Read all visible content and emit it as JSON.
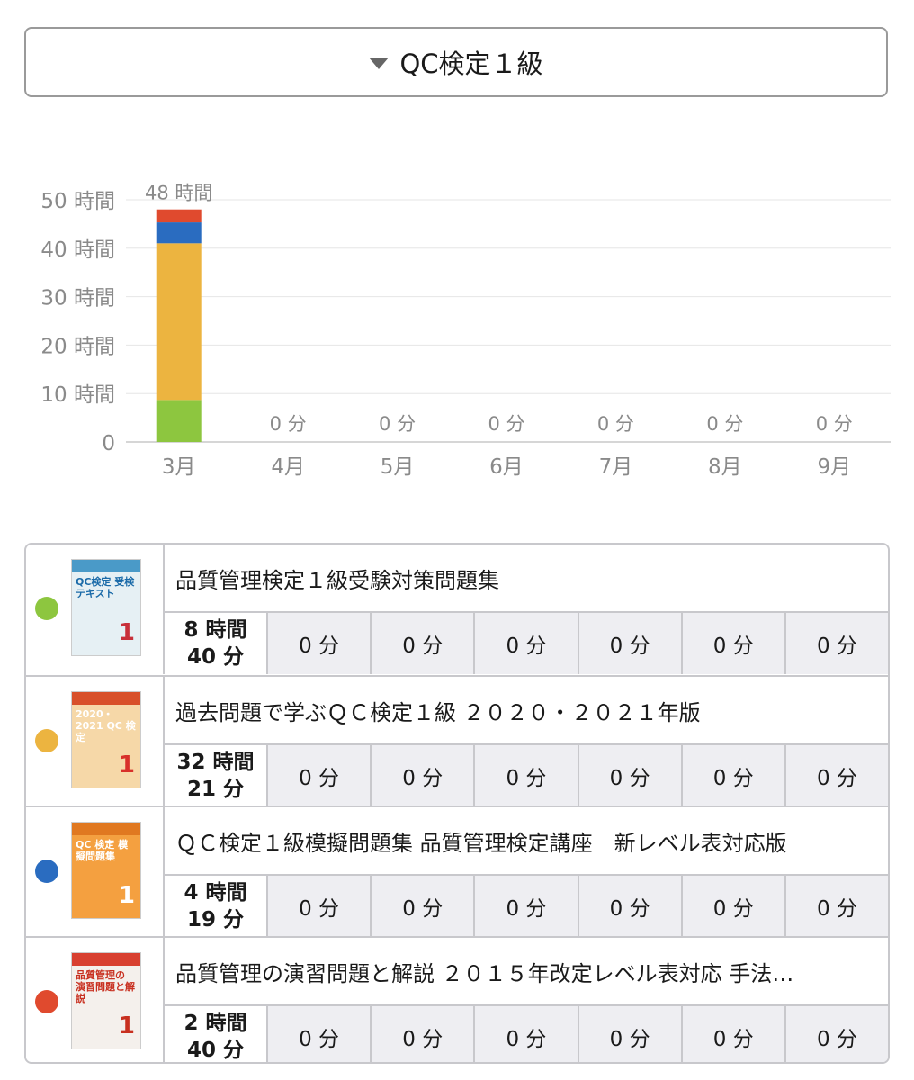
{
  "selector": {
    "label": "QC検定１級",
    "icon": "triangle-down-icon"
  },
  "chart_data": {
    "type": "bar",
    "stacked": true,
    "categories": [
      "3月",
      "4月",
      "5月",
      "6月",
      "7月",
      "8月",
      "9月"
    ],
    "ylim": [
      0,
      50
    ],
    "y_ticks": [
      0,
      10,
      20,
      30,
      40,
      50
    ],
    "y_tick_labels": [
      "0",
      "10 時間",
      "20 時間",
      "30 時間",
      "40 時間",
      "50 時間"
    ],
    "bar_labels": [
      "48 時間",
      "0 分",
      "0 分",
      "0 分",
      "0 分",
      "0 分",
      "0 分"
    ],
    "grid": true,
    "series": [
      {
        "color": "#8dc63f",
        "values": [
          8.67,
          0,
          0,
          0,
          0,
          0,
          0
        ]
      },
      {
        "color": "#ecb440",
        "values": [
          32.35,
          0,
          0,
          0,
          0,
          0,
          0
        ]
      },
      {
        "color": "#2a6cc0",
        "values": [
          4.32,
          0,
          0,
          0,
          0,
          0,
          0
        ]
      },
      {
        "color": "#e04a2e",
        "values": [
          2.67,
          0,
          0,
          0,
          0,
          0,
          0
        ]
      }
    ]
  },
  "books": [
    {
      "title": "品質管理検定１級受験対策問題集",
      "dot_color": "#8dc63f",
      "cover": {
        "bg": "#e6f0f4",
        "band": "#4a9ac8",
        "text": "QC検定 受検テキスト",
        "num": "1",
        "text_color": "#1a6aa8",
        "num_color": "#c8303a"
      },
      "total_h": "8 時間",
      "total_m": "40 分",
      "months": [
        "0 分",
        "0 分",
        "0 分",
        "0 分",
        "0 分",
        "0 分"
      ]
    },
    {
      "title": "過去問題で学ぶＱＣ検定１級 ２０２０・２０２１年版",
      "dot_color": "#ecb440",
      "cover": {
        "bg": "#f6d8a8",
        "band": "#d8502a",
        "text": "2020・2021 QC 検定",
        "num": "1",
        "text_color": "#ffffff",
        "num_color": "#d8302a"
      },
      "total_h": "32 時間",
      "total_m": "21 分",
      "months": [
        "0 分",
        "0 分",
        "0 分",
        "0 分",
        "0 分",
        "0 分"
      ]
    },
    {
      "title": "ＱＣ検定１級模擬問題集 品質管理検定講座　新レベル表対応版",
      "dot_color": "#2a6cc0",
      "cover": {
        "bg": "#f4a040",
        "band": "#e07820",
        "text": "QC 検定 模擬問題集",
        "num": "1",
        "text_color": "#ffffff",
        "num_color": "#ffffff"
      },
      "total_h": "4 時間",
      "total_m": "19 分",
      "months": [
        "0 分",
        "0 分",
        "0 分",
        "0 分",
        "0 分",
        "0 分"
      ]
    },
    {
      "title": "品質管理の演習問題と解説 ２０１５年改定レベル表対応 手法…",
      "dot_color": "#e04a2e",
      "cover": {
        "bg": "#f4f0ec",
        "band": "#d84030",
        "text": "品質管理の 演習問題と解説",
        "num": "1",
        "text_color": "#c83020",
        "num_color": "#c83020"
      },
      "total_h": "2 時間",
      "total_m": "40 分",
      "months": [
        "0 分",
        "0 分",
        "0 分",
        "0 分",
        "0 分",
        "0 分"
      ]
    }
  ]
}
